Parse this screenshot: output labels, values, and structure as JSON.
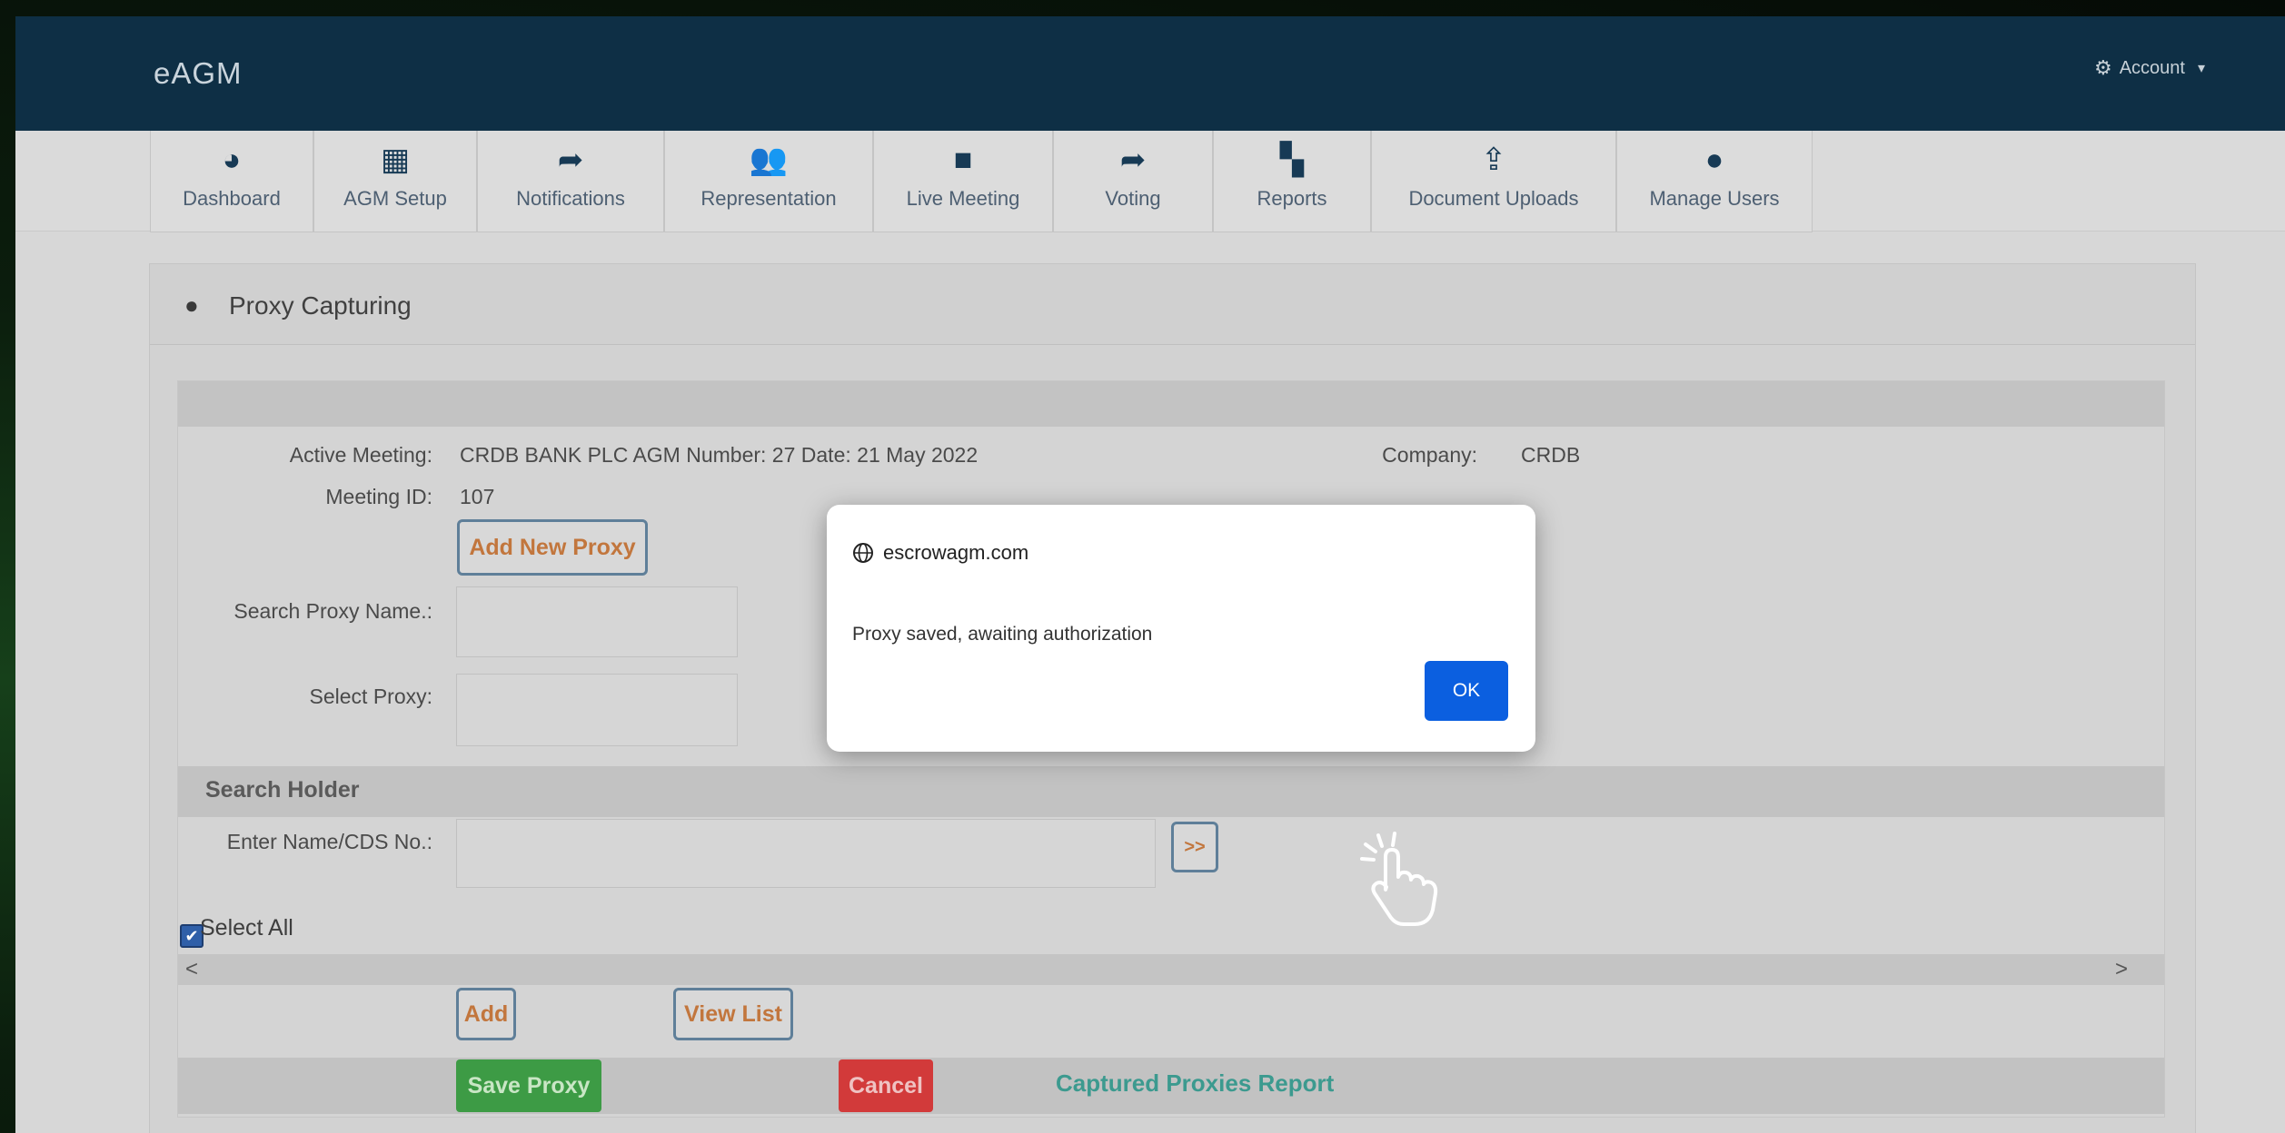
{
  "header": {
    "brand": "eAGM",
    "account_label": "Account",
    "account_caret": "▾"
  },
  "nav": {
    "items": [
      {
        "label": "Dashboard",
        "icon": "dashboard-gauge-icon",
        "glyph": "◕"
      },
      {
        "label": "AGM Setup",
        "icon": "calendar-icon",
        "glyph": "▦"
      },
      {
        "label": "Notifications",
        "icon": "share-arrow-icon",
        "glyph": "➦"
      },
      {
        "label": "Representation",
        "icon": "users-group-icon",
        "glyph": "👥"
      },
      {
        "label": "Live Meeting",
        "icon": "video-camera-icon",
        "glyph": "■"
      },
      {
        "label": "Voting",
        "icon": "share-arrow-icon",
        "glyph": "➦"
      },
      {
        "label": "Reports",
        "icon": "grid-icon",
        "glyph": "▚"
      },
      {
        "label": "Document Uploads",
        "icon": "upload-icon",
        "glyph": "⇪"
      },
      {
        "label": "Manage Users",
        "icon": "user-icon",
        "glyph": "●"
      }
    ]
  },
  "panel": {
    "title": "Proxy Capturing"
  },
  "form": {
    "active_meeting_label": "Active Meeting:",
    "active_meeting_value": "CRDB BANK PLC AGM Number: 27 Date: 21 May 2022",
    "company_label": "Company:",
    "company_value": "CRDB",
    "meeting_id_label": "Meeting ID:",
    "meeting_id_value": "107",
    "add_new_proxy": "Add New Proxy",
    "search_proxy_label": "Search Proxy Name.:",
    "select_proxy_label": "Select Proxy:",
    "search_holder_title": "Search Holder",
    "enter_name_label": "Enter Name/CDS No.:",
    "go_button": ">>",
    "select_all": "Select All",
    "add_button": "Add",
    "view_list_button": "View List",
    "save_proxy_button": "Save Proxy",
    "cancel_button": "Cancel",
    "report_link": "Captured Proxies Report"
  },
  "dialog": {
    "domain": "escrowagm.com",
    "message": "Proxy saved, awaiting authorization",
    "ok": "OK"
  },
  "scroll": {
    "left": "<",
    "right": ">"
  }
}
